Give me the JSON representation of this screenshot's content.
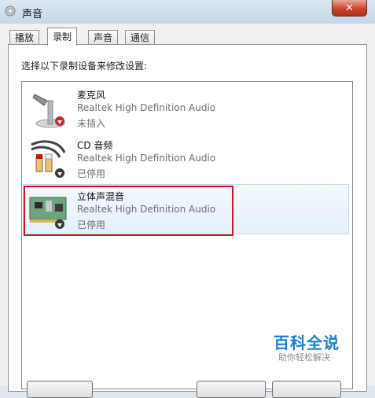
{
  "window": {
    "title": "声音"
  },
  "tabs": [
    {
      "label": "播放",
      "active": false
    },
    {
      "label": "录制",
      "active": true
    },
    {
      "label": "声音",
      "active": false
    },
    {
      "label": "通信",
      "active": false
    }
  ],
  "instruction": "选择以下录制设备来修改设置:",
  "devices": [
    {
      "name": "麦克风",
      "driver": "Realtek High Definition Audio",
      "status": "未插入",
      "icon": "microphone-icon"
    },
    {
      "name": "CD 音频",
      "driver": "Realtek High Definition Audio",
      "status": "已停用",
      "icon": "rca-cable-icon"
    },
    {
      "name": "立体声混音",
      "driver": "Realtek High Definition Audio",
      "status": "已停用",
      "icon": "sound-card-icon",
      "selected": true
    }
  ],
  "watermark": {
    "title": "百科全说",
    "subtitle": "助你轻松解决"
  },
  "colors": {
    "highlight": "#c8161e",
    "watermark": "#1a7fd6"
  }
}
